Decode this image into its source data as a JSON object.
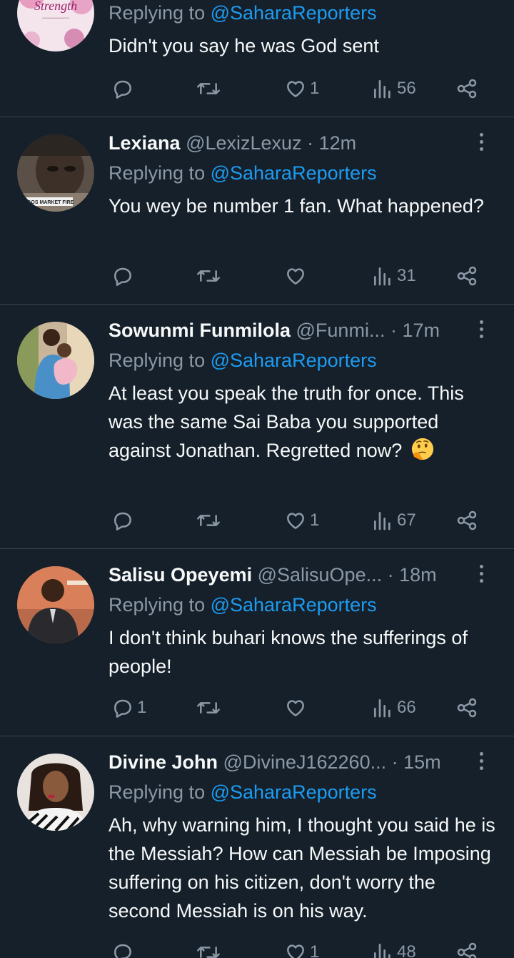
{
  "tweets": [
    {
      "name": "",
      "handle": "",
      "time": "",
      "replying_prefix": "Replying to ",
      "replying_to": "@SaharaReporters",
      "text": "Didn't you say he was God sent",
      "emoji": "",
      "replies": "",
      "retweets": "",
      "likes": "1",
      "views": "56",
      "avatar_caption": "Strength"
    },
    {
      "name": "Lexiana",
      "handle": "@LexizLexuz",
      "time": "12m",
      "replying_prefix": "Replying to ",
      "replying_to": "@SaharaReporters",
      "text": "You wey be number 1 fan. What happened?",
      "emoji": "",
      "replies": "",
      "retweets": "",
      "likes": "",
      "views": "31",
      "avatar_caption": "LAGOS MARKET FIRE"
    },
    {
      "name": "Sowunmi Funmilola",
      "handle": "@Funmi...",
      "time": "17m",
      "replying_prefix": "Replying to ",
      "replying_to": "@SaharaReporters",
      "text": "At least you speak the truth for once. This was the same Sai Baba you supported against Jonathan. Regretted now?",
      "emoji": "thinking-face",
      "replies": "",
      "retweets": "",
      "likes": "1",
      "views": "67",
      "avatar_caption": ""
    },
    {
      "name": "Salisu Opeyemi",
      "handle": "@SalisuOpe...",
      "time": "18m",
      "replying_prefix": "Replying to ",
      "replying_to": "@SaharaReporters",
      "text": "I don't think buhari knows the sufferings of people!",
      "emoji": "",
      "replies": "1",
      "retweets": "",
      "likes": "",
      "views": "66",
      "avatar_caption": ""
    },
    {
      "name": "Divine John",
      "handle": "@DivineJ162260...",
      "time": "15m",
      "replying_prefix": "Replying to ",
      "replying_to": "@SaharaReporters",
      "text": "Ah, why warning him, I thought you said he is the Messiah? How can Messiah be Imposing suffering on his citizen, don't worry the second Messiah is on his way.",
      "emoji": "",
      "replies": "",
      "retweets": "",
      "likes": "1",
      "views": "48",
      "avatar_caption": ""
    }
  ],
  "separator": "·",
  "icons": {
    "reply": "reply-icon",
    "retweet": "retweet-icon",
    "like": "heart-icon",
    "views": "views-icon",
    "share": "share-icon",
    "more": "more-icon"
  },
  "colors": {
    "background": "#15202b",
    "text": "#f7f9f9",
    "secondary": "#8b98a5",
    "link": "#1d9bf0",
    "divider": "#38444d"
  }
}
